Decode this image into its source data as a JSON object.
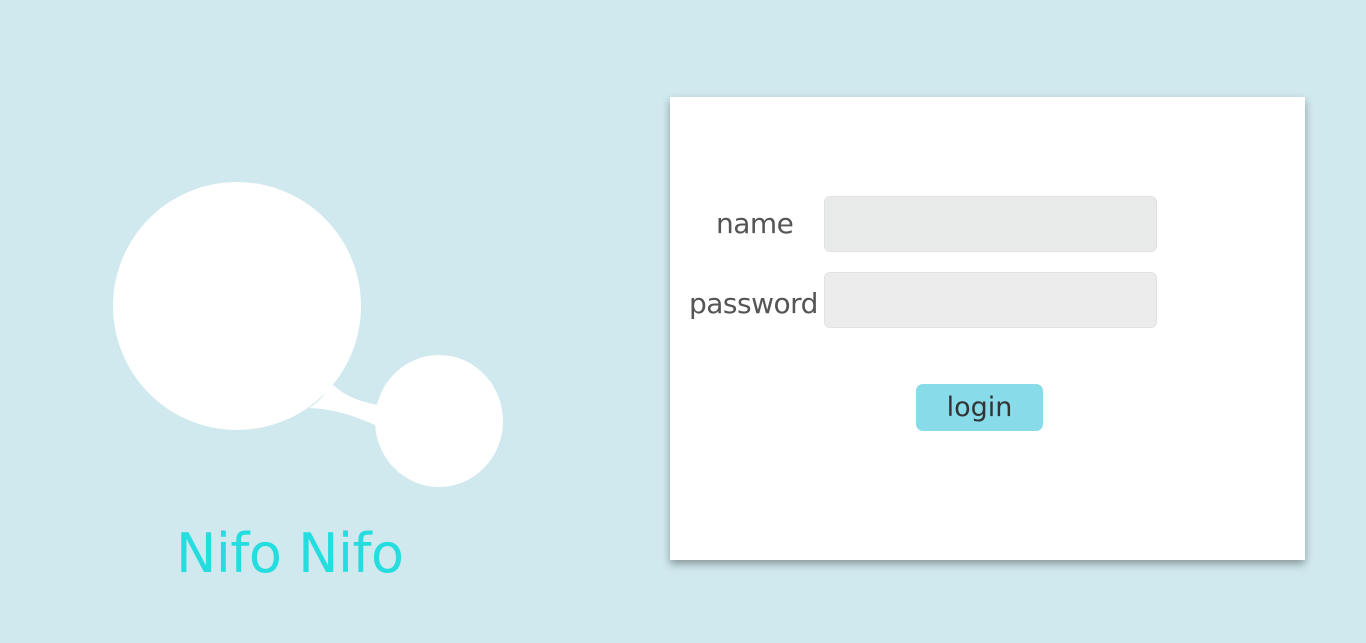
{
  "brand": {
    "name": "Nifo Nifo",
    "logo_icon": "speech-bubble-icon",
    "accent_color": "#25dddf"
  },
  "login_form": {
    "name_label": "name",
    "name_value": "",
    "name_placeholder": "",
    "password_label": "password",
    "password_value": "",
    "password_placeholder": "",
    "login_button_label": "login",
    "button_color": "#88dcea"
  },
  "background_color": "#d0e9ee"
}
